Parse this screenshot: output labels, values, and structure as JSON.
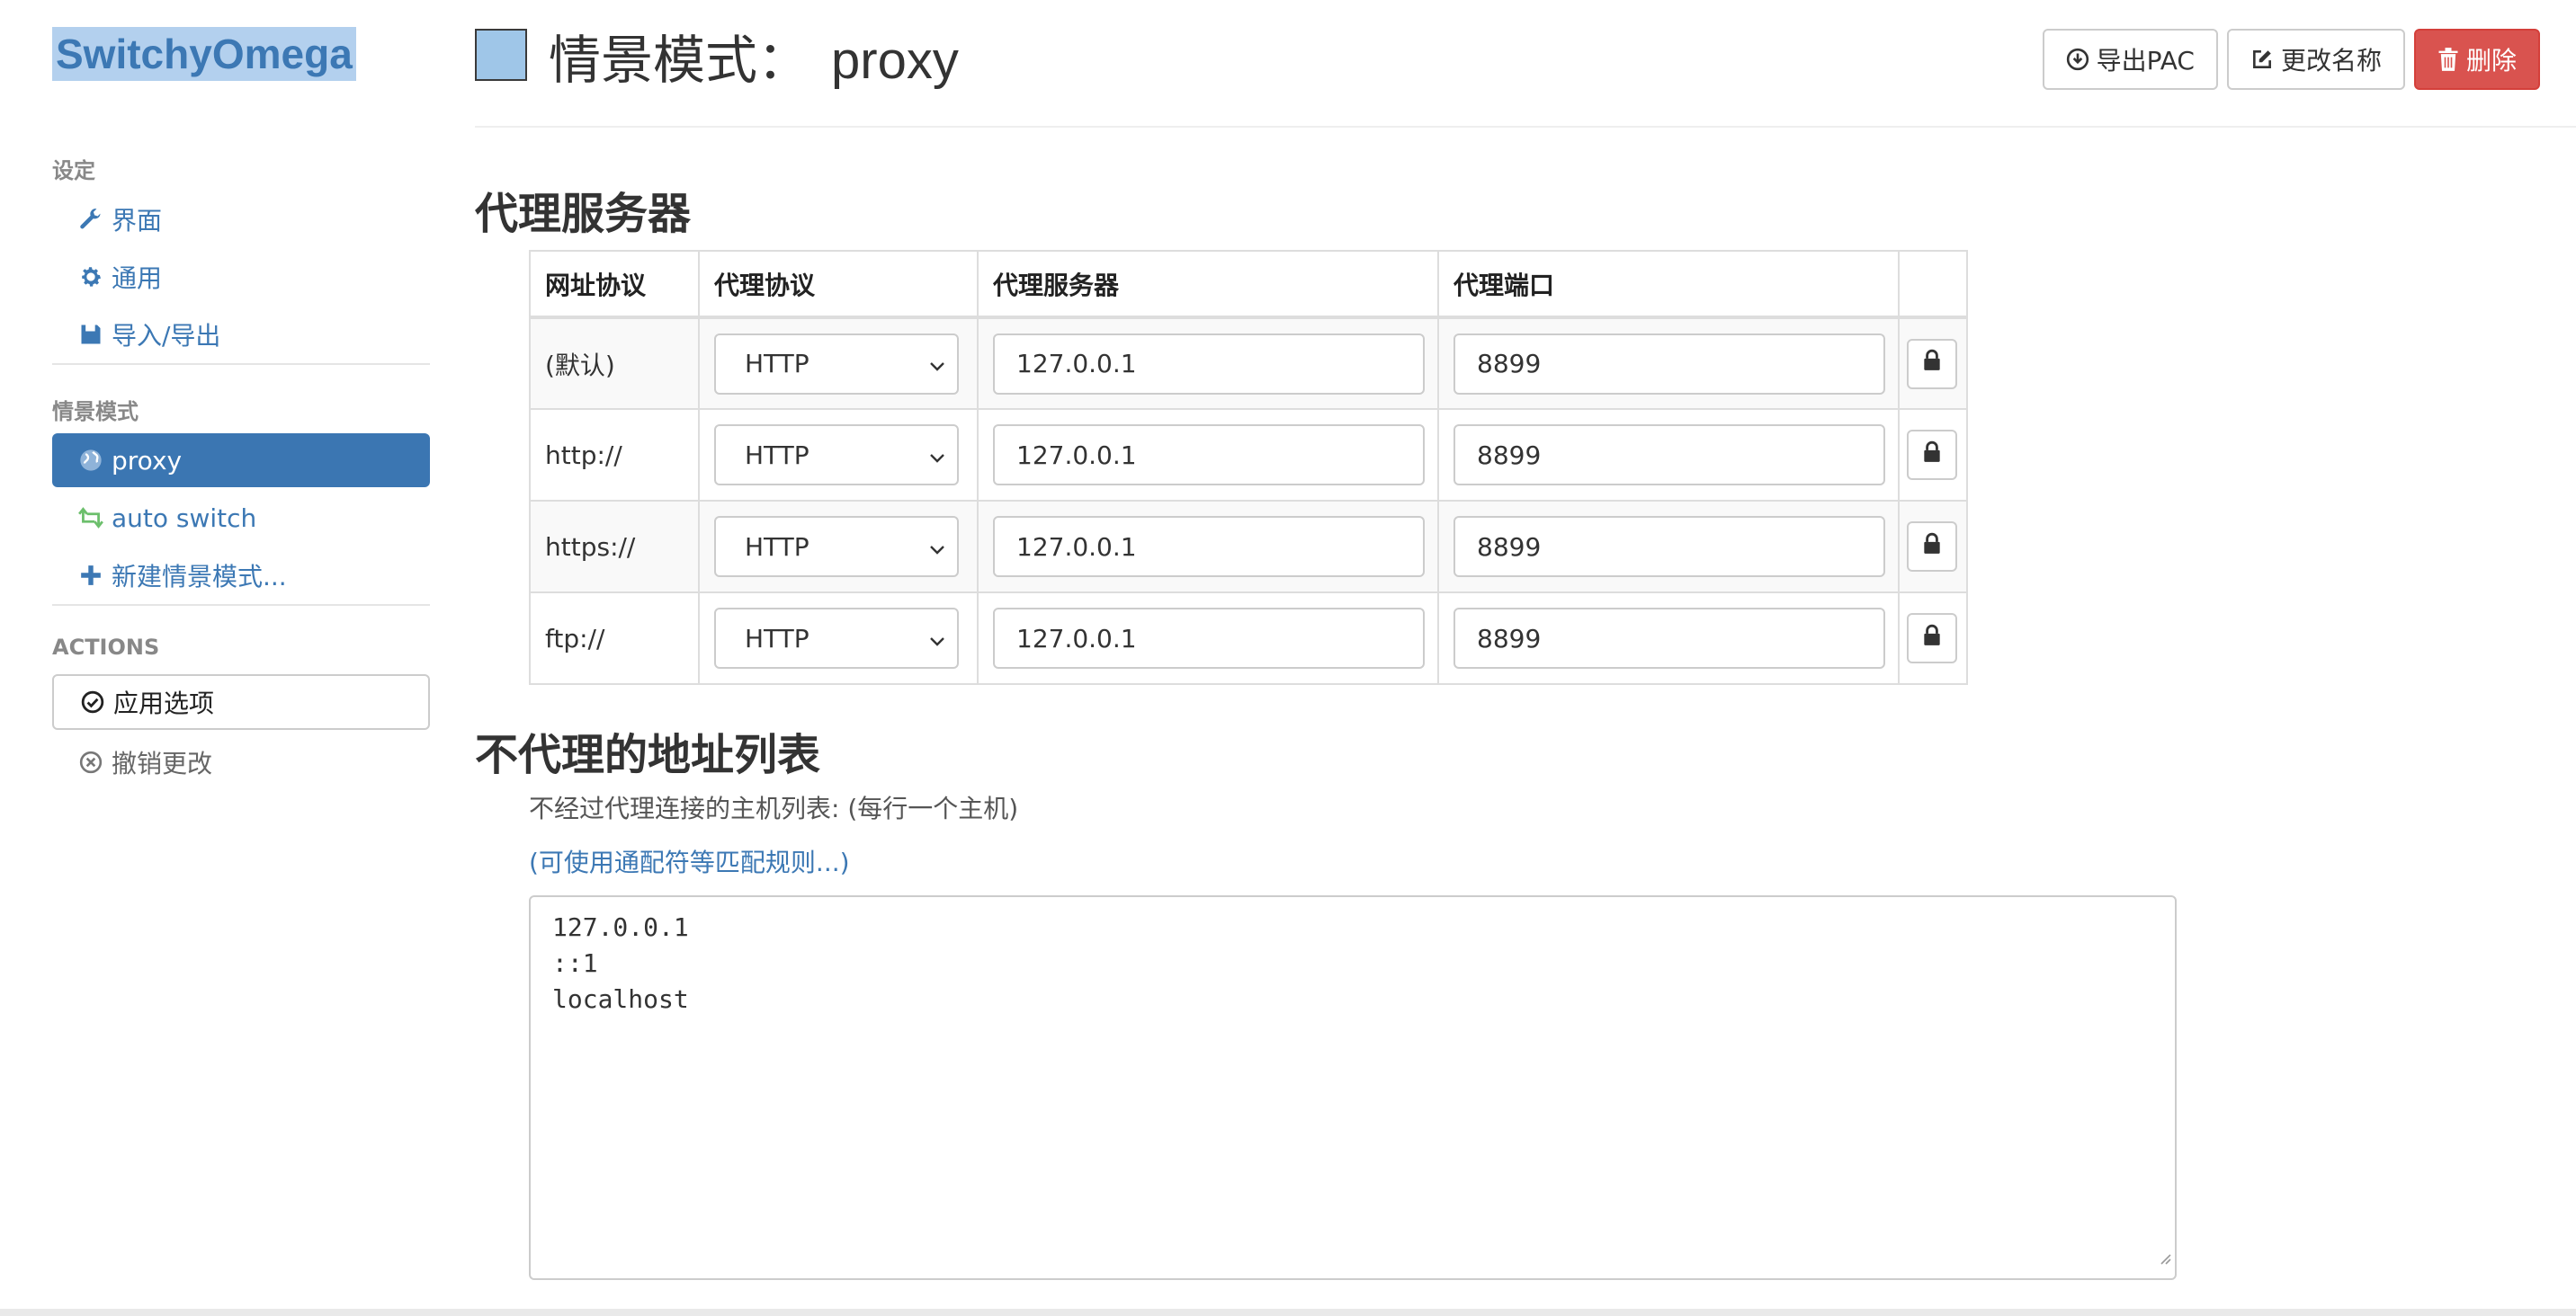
{
  "brand": "SwitchyOmega",
  "sidebar": {
    "settings_header": "设定",
    "settings_items": [
      {
        "label": "界面",
        "icon": "wrench-icon"
      },
      {
        "label": "通用",
        "icon": "gear-icon"
      },
      {
        "label": "导入/导出",
        "icon": "floppy-icon"
      }
    ],
    "profiles_header": "情景模式",
    "profile_items": [
      {
        "label": "proxy",
        "icon": "globe-icon",
        "active": true
      },
      {
        "label": "auto switch",
        "icon": "retweet-icon",
        "active": false
      },
      {
        "label": "新建情景模式...",
        "icon": "plus-icon",
        "active": false
      }
    ],
    "actions_header": "ACTIONS",
    "apply_label": "应用选项",
    "discard_label": "撤销更改"
  },
  "header": {
    "title_prefix": "情景模式：",
    "profile_name": "proxy",
    "profile_color": "#9fc6e8",
    "export_pac_label": "导出PAC",
    "rename_label": "更改名称",
    "delete_label": "删除"
  },
  "proxy_section": {
    "title": "代理服务器",
    "columns": [
      "网址协议",
      "代理协议",
      "代理服务器",
      "代理端口",
      ""
    ],
    "rows": [
      {
        "scheme": "(默认)",
        "protocol": "HTTP",
        "server": "127.0.0.1",
        "port": "8899"
      },
      {
        "scheme": "http://",
        "protocol": "HTTP",
        "server": "127.0.0.1",
        "port": "8899"
      },
      {
        "scheme": "https://",
        "protocol": "HTTP",
        "server": "127.0.0.1",
        "port": "8899"
      },
      {
        "scheme": "ftp://",
        "protocol": "HTTP",
        "server": "127.0.0.1",
        "port": "8899"
      }
    ]
  },
  "bypass_section": {
    "title": "不代理的地址列表",
    "description": "不经过代理连接的主机列表: (每行一个主机)",
    "wildcard_link": "(可使用通配符等匹配规则...)",
    "lines": [
      "127.0.0.1",
      "::1",
      "localhost"
    ]
  },
  "colors": {
    "accent": "#3c78b4",
    "active_bg": "#3b76b2",
    "danger": "#d9534f"
  }
}
